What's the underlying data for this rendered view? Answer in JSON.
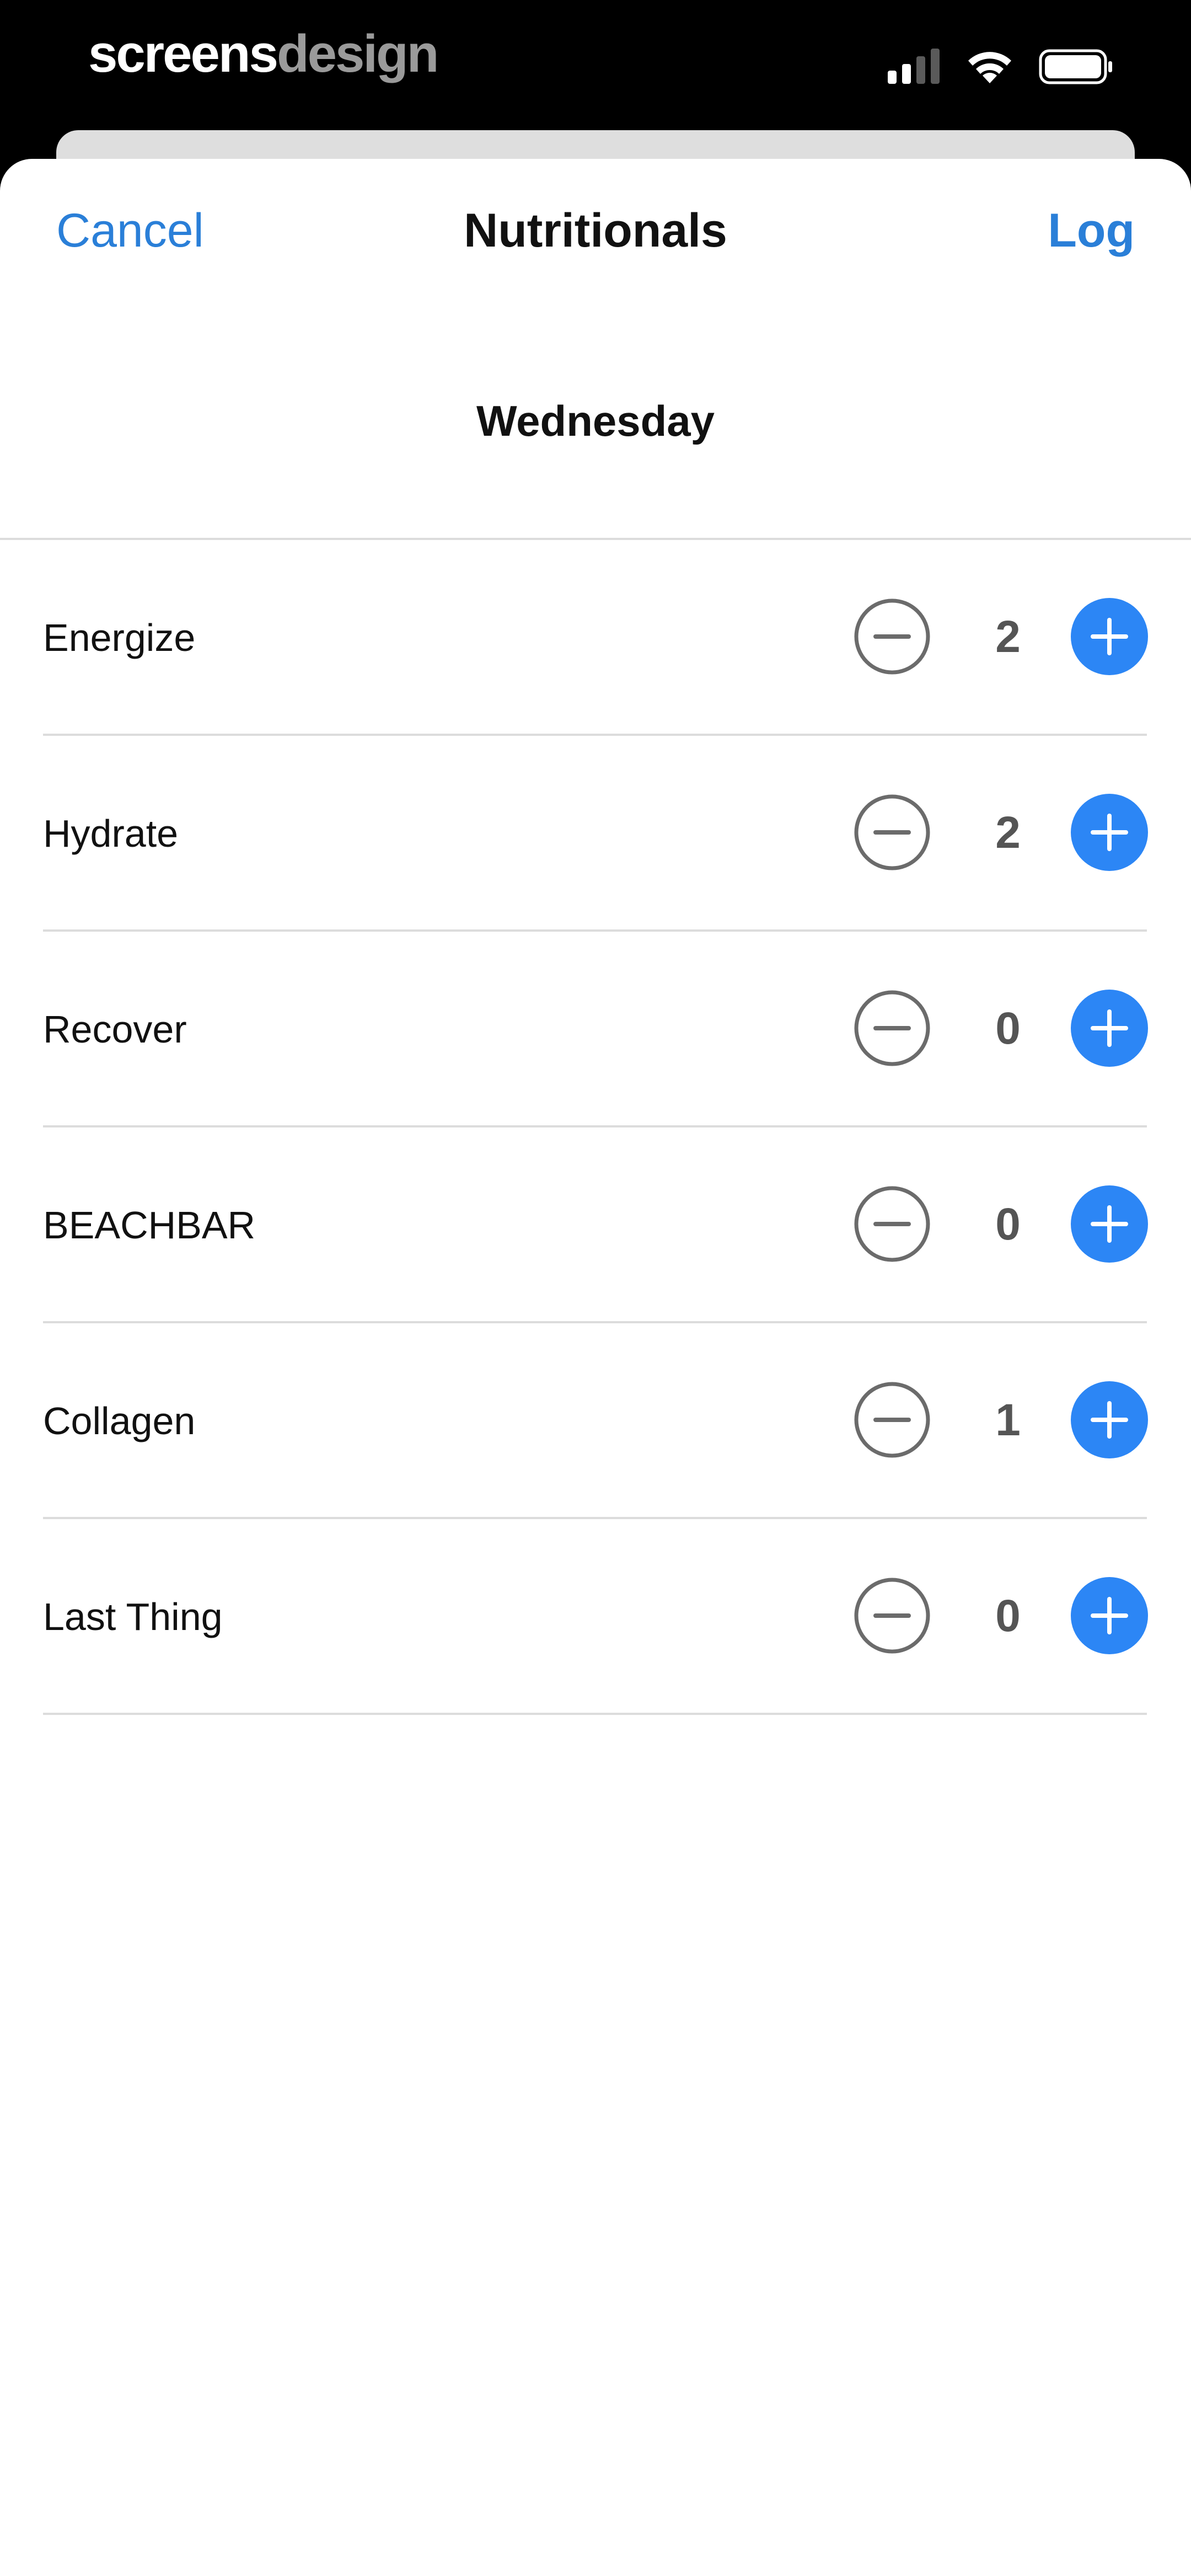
{
  "status_bar": {
    "watermark_part1": "screens",
    "watermark_part2": "design",
    "icons": [
      "cellular-signal-icon",
      "wifi-icon",
      "battery-icon"
    ]
  },
  "nav": {
    "cancel_label": "Cancel",
    "title": "Nutritionals",
    "log_label": "Log"
  },
  "day_label": "Wednesday",
  "items": [
    {
      "label": "Energize",
      "count": "2"
    },
    {
      "label": "Hydrate",
      "count": "2"
    },
    {
      "label": "Recover",
      "count": "0"
    },
    {
      "label": "BEACHBAR",
      "count": "0"
    },
    {
      "label": "Collagen",
      "count": "1"
    },
    {
      "label": "Last Thing",
      "count": "0"
    }
  ],
  "colors": {
    "accent": "#2a7fd8",
    "plus_button": "#2c86f5",
    "minus_button_outline": "#6b6b6b",
    "divider": "#dcdcdc",
    "sheet_background": "#ffffff",
    "status_background": "#000000"
  }
}
